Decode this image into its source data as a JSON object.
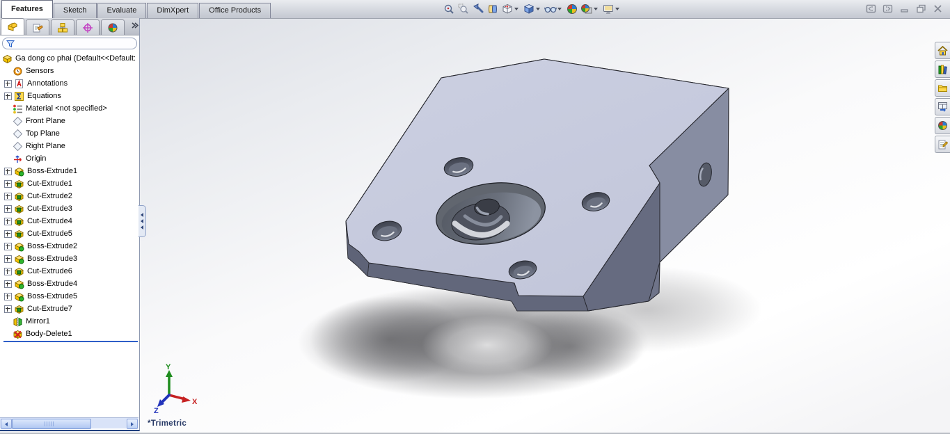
{
  "command_tabs": [
    {
      "label": "Features",
      "active": true
    },
    {
      "label": "Sketch",
      "active": false
    },
    {
      "label": "Evaluate",
      "active": false
    },
    {
      "label": "DimXpert",
      "active": false
    },
    {
      "label": "Office Products",
      "active": false
    }
  ],
  "view_toolbar_icons": [
    "zoom-to-fit",
    "zoom-to-area",
    "previous-view",
    "section-view",
    "view-orientation",
    "display-style",
    "hide-show-items",
    "edit-appearance",
    "apply-scene",
    "view-settings"
  ],
  "window_controls": [
    "collapse-left-pane",
    "collapse-right-pane",
    "minimize",
    "restore",
    "close"
  ],
  "feature_manager": {
    "tab_icons": [
      "featuremanager-tree",
      "propertymanager",
      "configurationmanager",
      "dimxpertmanager",
      "displaymanager"
    ],
    "root_label": "Ga dong co phai  (Default<<Default:",
    "items": [
      {
        "label": "Sensors",
        "icon": "sensors",
        "expandable": false
      },
      {
        "label": "Annotations",
        "icon": "annotations",
        "expandable": true
      },
      {
        "label": "Equations",
        "icon": "equations",
        "expandable": true
      },
      {
        "label": "Material <not specified>",
        "icon": "material",
        "expandable": false
      },
      {
        "label": "Front Plane",
        "icon": "plane",
        "expandable": false
      },
      {
        "label": "Top Plane",
        "icon": "plane",
        "expandable": false
      },
      {
        "label": "Right Plane",
        "icon": "plane",
        "expandable": false
      },
      {
        "label": "Origin",
        "icon": "origin",
        "expandable": false
      },
      {
        "label": "Boss-Extrude1",
        "icon": "boss",
        "expandable": true
      },
      {
        "label": "Cut-Extrude1",
        "icon": "cut",
        "expandable": true
      },
      {
        "label": "Cut-Extrude2",
        "icon": "cut",
        "expandable": true
      },
      {
        "label": "Cut-Extrude3",
        "icon": "cut",
        "expandable": true
      },
      {
        "label": "Cut-Extrude4",
        "icon": "cut",
        "expandable": true
      },
      {
        "label": "Cut-Extrude5",
        "icon": "cut",
        "expandable": true
      },
      {
        "label": "Boss-Extrude2",
        "icon": "boss",
        "expandable": true
      },
      {
        "label": "Boss-Extrude3",
        "icon": "boss",
        "expandable": true
      },
      {
        "label": "Cut-Extrude6",
        "icon": "cut",
        "expandable": true
      },
      {
        "label": "Boss-Extrude4",
        "icon": "boss",
        "expandable": true
      },
      {
        "label": "Boss-Extrude5",
        "icon": "boss",
        "expandable": true
      },
      {
        "label": "Cut-Extrude7",
        "icon": "cut",
        "expandable": true
      },
      {
        "label": "Mirror1",
        "icon": "mirror",
        "expandable": false
      },
      {
        "label": "Body-Delete1",
        "icon": "bodydelete",
        "expandable": false
      }
    ]
  },
  "task_pane_icons": [
    "solidworks-resources-home",
    "design-library",
    "file-explorer",
    "view-palette",
    "appearances-scenes",
    "custom-properties"
  ],
  "viewport": {
    "view_orientation_label": "*Trimetric",
    "triad": {
      "x": "X",
      "y": "Y",
      "z": "Z"
    }
  },
  "colors": {
    "part_top_face": "#C7CBDF",
    "part_side_face": "#878DA2",
    "part_dark_face": "#666B80",
    "rollback_bar": "#2E5EC8",
    "triad_x": "#D02020",
    "triad_y": "#2FA12F",
    "triad_z": "#2040C0",
    "view_label_text": "#283A66"
  }
}
